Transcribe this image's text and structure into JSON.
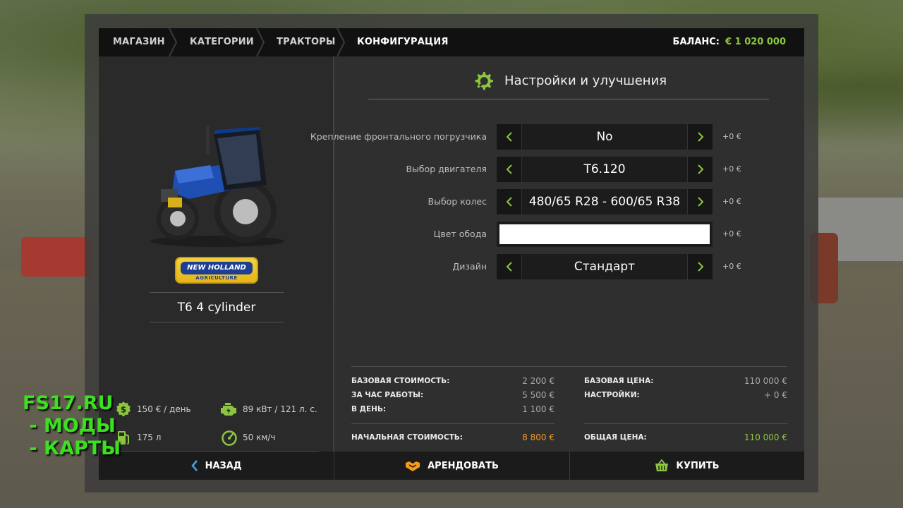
{
  "nav": {
    "crumbs": [
      "МАГАЗИН",
      "КАТЕГОРИИ",
      "ТРАКТОРЫ",
      "КОНФИГУРАЦИЯ"
    ],
    "balance_label": "БАЛАНС:",
    "balance_value": "€ 1 020 000"
  },
  "vehicle": {
    "model": "T6 4 cylinder",
    "brand_logo_text": "NEW HOLLAND",
    "brand_logo_sub": "AGRICULTURE",
    "specs": {
      "cost_per_day": "150 € / день",
      "power": "89 кВт / 121 л. с.",
      "fuel": "175 л",
      "speed": "50 км/ч"
    }
  },
  "config": {
    "title": "Настройки и улучшения",
    "options": [
      {
        "label": "Крепление фронтального погрузчика",
        "value": "No",
        "price": "+0 €"
      },
      {
        "label": "Выбор двигателя",
        "value": "T6.120",
        "price": "+0 €"
      },
      {
        "label": "Выбор колес",
        "value": "480/65 R28 - 600/65 R38",
        "price": "+0 €"
      },
      {
        "label": "Цвет обода",
        "color": "#ffffff",
        "price": "+0 €"
      },
      {
        "label": "Дизайн",
        "value": "Стандарт",
        "price": "+0 €"
      }
    ]
  },
  "costs": {
    "left": [
      {
        "label": "БАЗОВАЯ СТОИМОСТЬ:",
        "value": "2 200 €"
      },
      {
        "label": "ЗА ЧАС РАБОТЫ:",
        "value": "5 500 €"
      },
      {
        "label": "В ДЕНЬ:",
        "value": "1 100 €"
      }
    ],
    "left_total": {
      "label": "НАЧАЛЬНАЯ СТОИМОСТЬ:",
      "value": "8 800 €"
    },
    "right": [
      {
        "label": "БАЗОВАЯ ЦЕНА:",
        "value": "110 000 €"
      },
      {
        "label": "НАСТРОЙКИ:",
        "value": "+ 0 €"
      }
    ],
    "right_total": {
      "label": "ОБЩАЯ ЦЕНА:",
      "value": "110 000 €"
    }
  },
  "buttons": {
    "back": "НАЗАД",
    "lease": "АРЕНДОВАТЬ",
    "buy": "КУПИТЬ"
  },
  "watermark": {
    "line1": "FS17.RU",
    "line2": " - МОДЫ",
    "line3": " - КАРТЫ"
  },
  "colors": {
    "accent_green": "#8cc63f",
    "accent_orange": "#f39b1c"
  },
  "icons": {
    "settings": "gear-wrench-icon",
    "money": "coin-icon",
    "engine": "engine-icon",
    "fuel": "fuel-icon",
    "speed": "speedometer-icon",
    "back": "chevron-left-icon",
    "lease": "handshake-icon",
    "buy": "basket-icon"
  }
}
